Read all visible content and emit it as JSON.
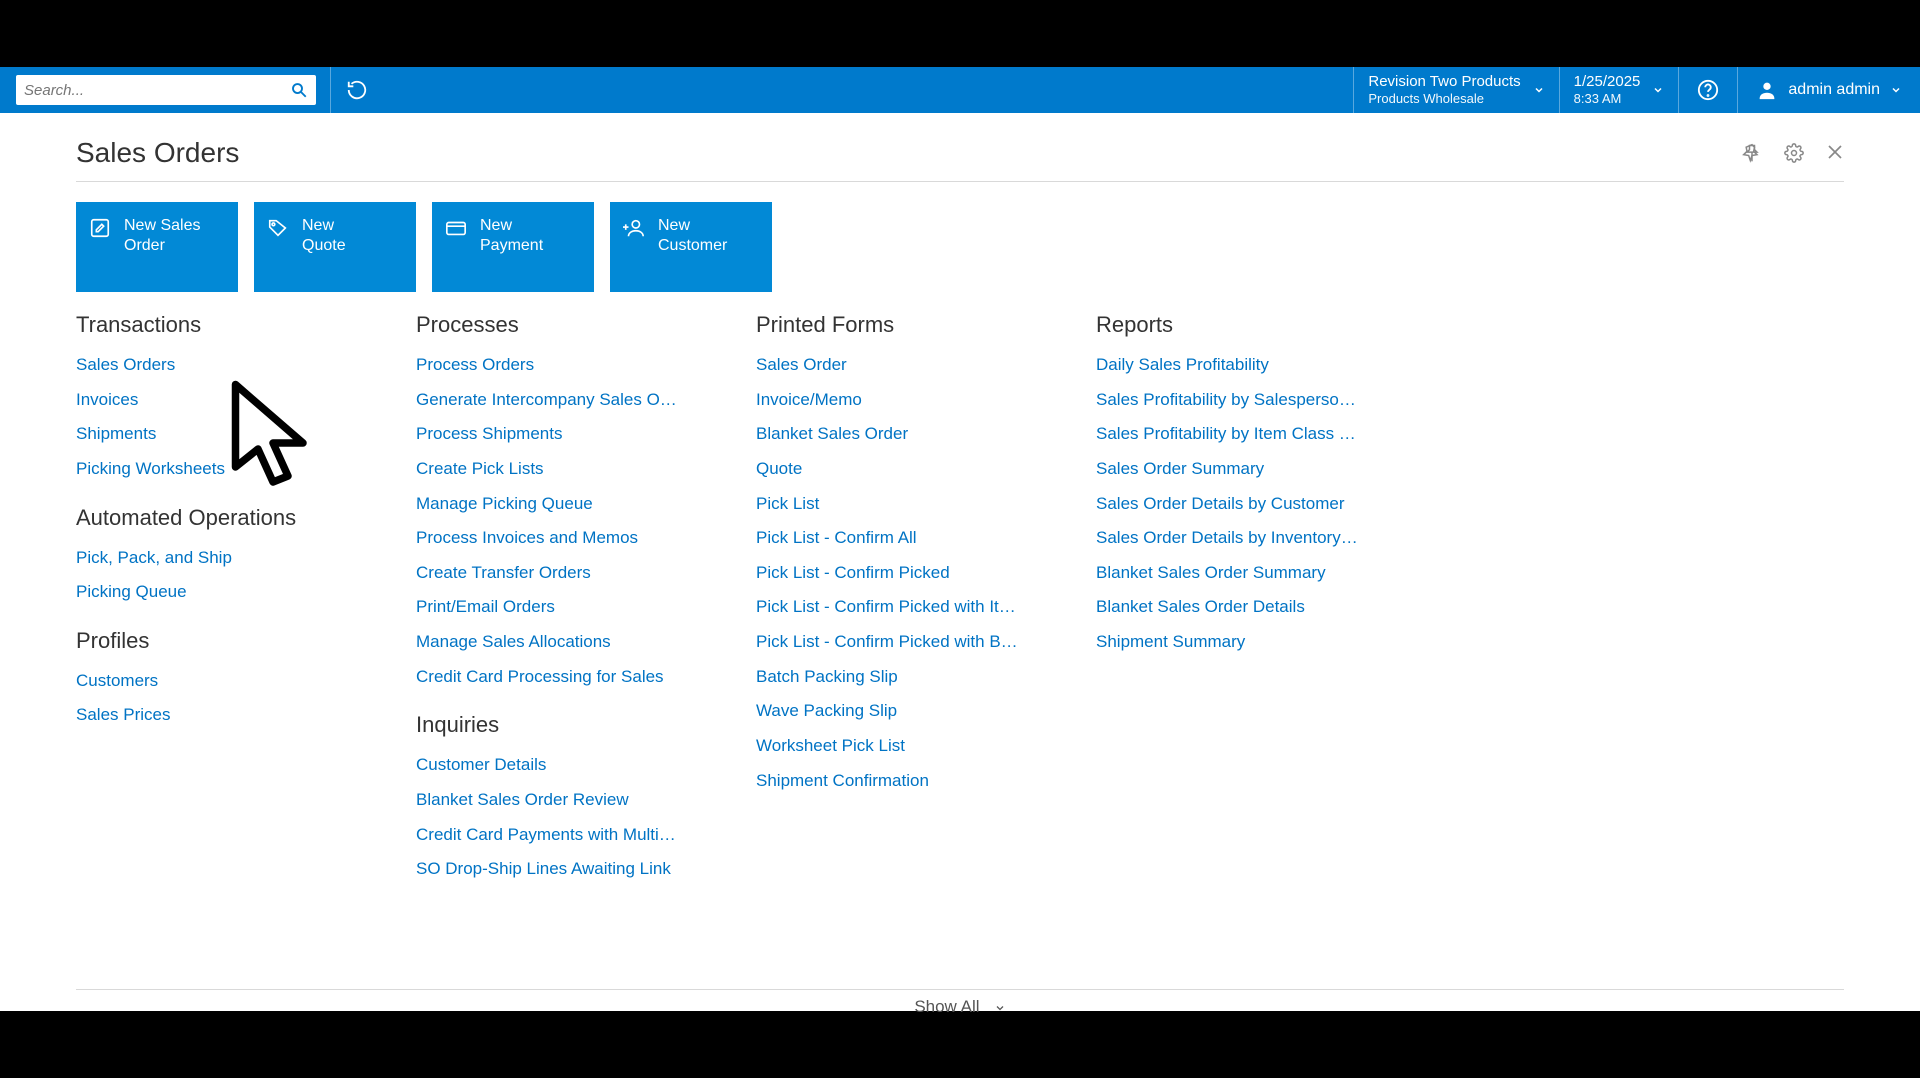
{
  "topbar": {
    "search_placeholder": "Search...",
    "tenant_name": "Revision Two Products",
    "tenant_sub": "Products Wholesale",
    "date": "1/25/2025",
    "time": "8:33 AM",
    "user": "admin admin"
  },
  "page": {
    "title": "Sales Orders",
    "show_all": "Show All"
  },
  "tiles": [
    {
      "icon": "edit-icon",
      "label1": "New Sales",
      "label2": "Order"
    },
    {
      "icon": "tag-icon",
      "label1": "New",
      "label2": "Quote"
    },
    {
      "icon": "card-icon",
      "label1": "New",
      "label2": "Payment"
    },
    {
      "icon": "add-user-icon",
      "label1": "New",
      "label2": "Customer"
    }
  ],
  "sections": {
    "col1": [
      {
        "heading": "Transactions",
        "links": [
          "Sales Orders",
          "Invoices",
          "Shipments",
          "Picking Worksheets"
        ]
      },
      {
        "heading": "Automated Operations",
        "links": [
          "Pick, Pack, and Ship",
          "Picking Queue"
        ]
      },
      {
        "heading": "Profiles",
        "links": [
          "Customers",
          "Sales Prices"
        ]
      }
    ],
    "col2": [
      {
        "heading": "Processes",
        "links": [
          "Process Orders",
          "Generate Intercompany Sales O…",
          "Process Shipments",
          "Create Pick Lists",
          "Manage Picking Queue",
          "Process Invoices and Memos",
          "Create Transfer Orders",
          "Print/Email Orders",
          "Manage Sales Allocations",
          "Credit Card Processing for Sales"
        ]
      },
      {
        "heading": "Inquiries",
        "links": [
          "Customer Details",
          "Blanket Sales Order Review",
          "Credit Card Payments with Multi…",
          "SO Drop-Ship Lines Awaiting Link"
        ]
      }
    ],
    "col3": [
      {
        "heading": "Printed Forms",
        "links": [
          "Sales Order",
          "Invoice/Memo",
          "Blanket Sales Order",
          "Quote",
          "Pick List",
          "Pick List - Confirm All",
          "Pick List - Confirm Picked",
          "Pick List - Confirm Picked with It…",
          "Pick List - Confirm Picked with B…",
          "Batch Packing Slip",
          "Wave Packing Slip",
          "Worksheet Pick List",
          "Shipment Confirmation"
        ]
      }
    ],
    "col4": [
      {
        "heading": "Reports",
        "links": [
          "Daily Sales Profitability",
          "Sales Profitability by Salesperso…",
          "Sales Profitability by Item Class …",
          "Sales Order Summary",
          "Sales Order Details by Customer",
          "Sales Order Details by Inventory…",
          "Blanket Sales Order Summary",
          "Blanket Sales Order Details",
          "Shipment Summary"
        ]
      }
    ]
  }
}
